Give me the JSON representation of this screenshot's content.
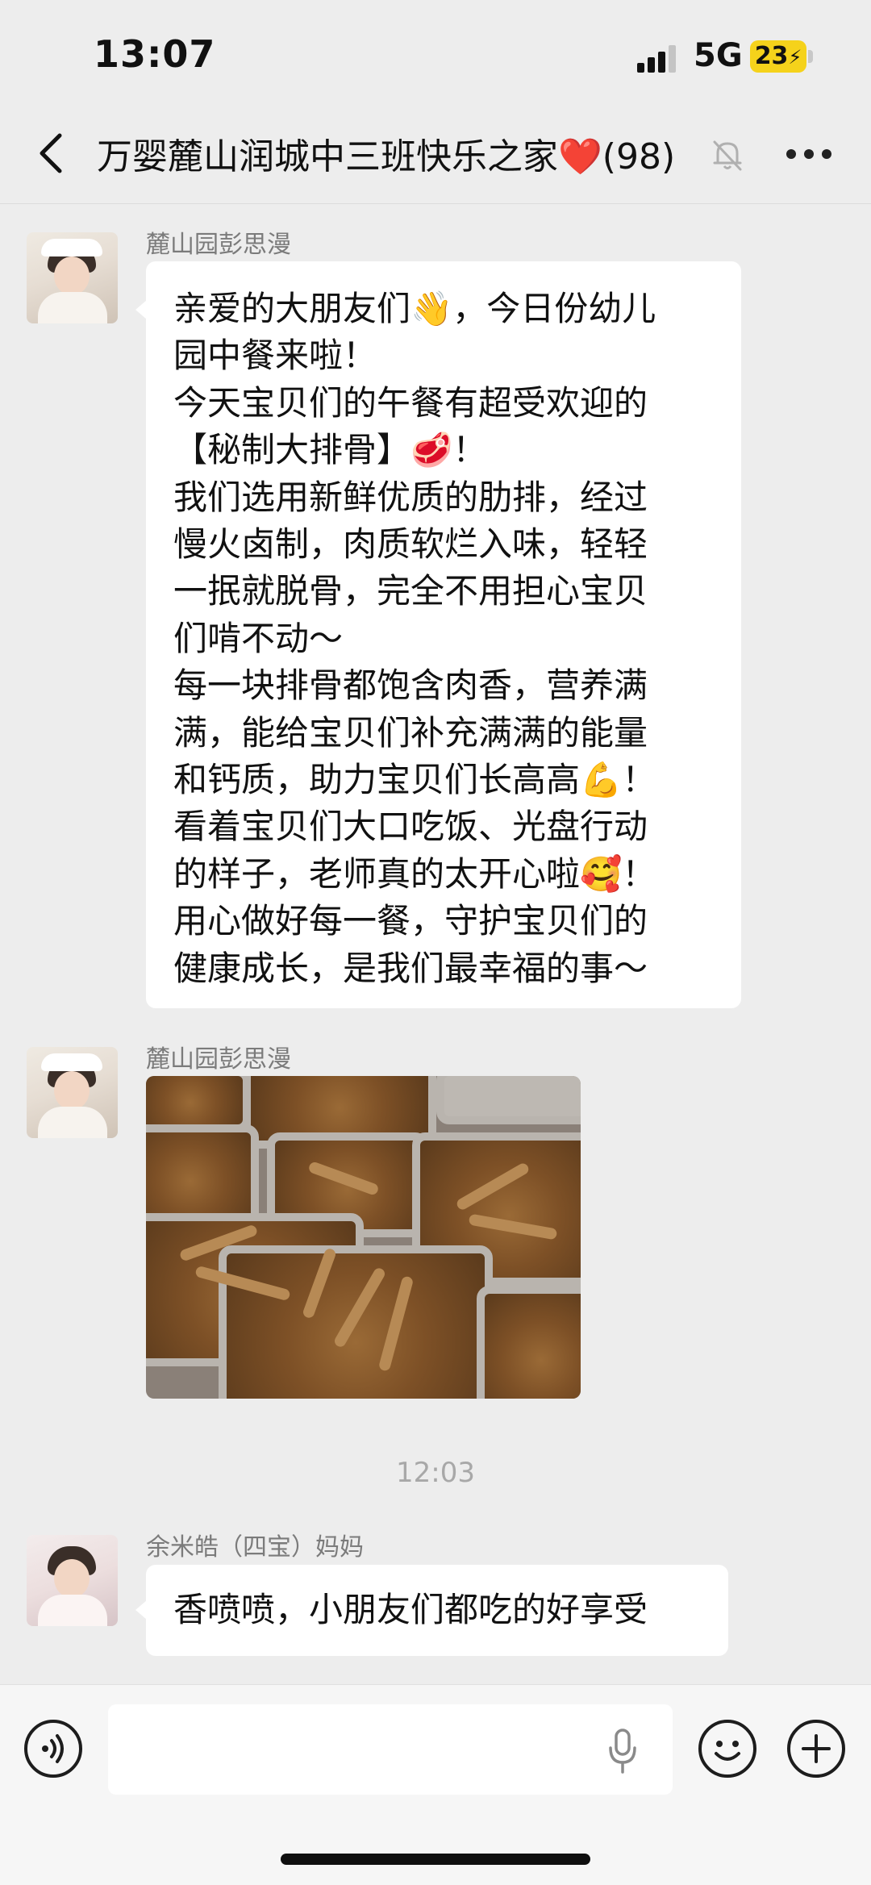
{
  "status_bar": {
    "time": "13:07",
    "network": "5G",
    "battery_level": "23",
    "colors": {
      "battery": "#f5d21b"
    }
  },
  "nav": {
    "title": "万婴麓山润城中三班快乐之家",
    "title_emoji": "❤️",
    "member_count": "(98)",
    "icons": [
      "back-icon",
      "mute-bell-icon",
      "more-icon"
    ]
  },
  "messages": [
    {
      "sender": "麓山园彭思漫",
      "lines": [
        "亲爱的大朋友们👋，今日份幼儿",
        "园中餐来啦！",
        "今天宝贝们的午餐有超受欢迎的",
        "【秘制大排骨】🥩！",
        "我们选用新鲜优质的肋排，经过",
        "慢火卤制，肉质软烂入味，轻轻",
        "一抿就脱骨，完全不用担心宝贝",
        "们啃不动～",
        "每一块排骨都饱含肉香，营养满",
        "满，能给宝贝们补充满满的能量",
        "和钙质，助力宝贝们长高高💪！",
        "看着宝贝们大口吃饭、光盘行动",
        "的样子，老师真的太开心啦🥰！",
        "用心做好每一餐，守护宝贝们的",
        "健康成长，是我们最幸福的事～"
      ]
    },
    {
      "sender": "麓山园彭思漫",
      "photo": "braised-ribs-trays-photo"
    },
    {
      "sender": "余米皓（四宝）妈妈",
      "text": "香喷喷，小朋友们都吃的好享受"
    }
  ],
  "timestamp": "12:03",
  "input_bar": {
    "icons": [
      "voice-icon",
      "mic-icon",
      "emoji-icon",
      "plus-icon"
    ]
  }
}
